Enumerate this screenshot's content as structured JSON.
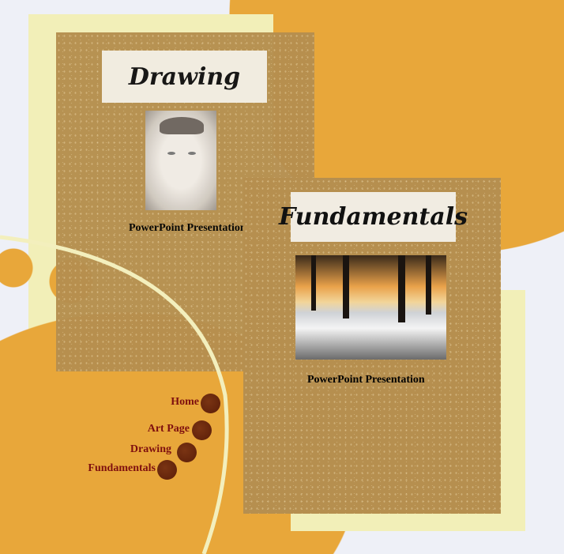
{
  "cards": [
    {
      "title": "Drawing",
      "caption": "PowerPoint Presentation",
      "image": "portrait-sketch"
    },
    {
      "title": "Fundamentals",
      "caption": "PowerPoint Presentation",
      "image": "winter-forest-painting"
    }
  ],
  "nav": {
    "items": [
      {
        "label": "Home"
      },
      {
        "label": "Art Page"
      },
      {
        "label": "Drawing"
      },
      {
        "label": "Fundamentals"
      }
    ]
  },
  "colors": {
    "orange": "#e8a73a",
    "card": "#b68f4f",
    "cream": "#f2efb8",
    "nav_text": "#7e0f0f"
  }
}
